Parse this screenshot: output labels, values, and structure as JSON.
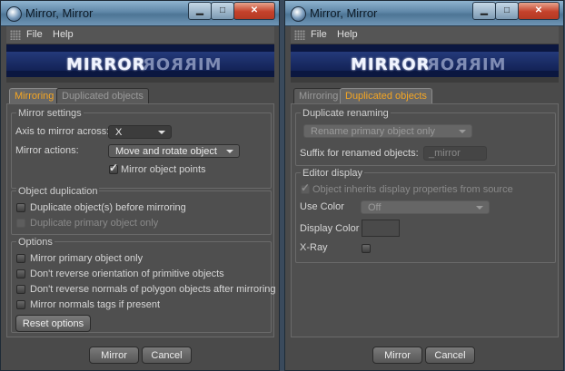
{
  "left_window": {
    "title": "Mirror, Mirror",
    "menu": {
      "file": "File",
      "help": "Help"
    },
    "banner": {
      "word": "MIRROR",
      "reflection": "MIRROR"
    },
    "tabs": [
      {
        "label": "Mirroring",
        "active": true
      },
      {
        "label": "Duplicated objects",
        "active": false
      }
    ],
    "mirror_settings": {
      "title": "Mirror settings",
      "axis_label": "Axis to mirror across:",
      "axis_value": "X",
      "actions_label": "Mirror actions:",
      "actions_value": "Move and rotate object",
      "mirror_points_label": "Mirror object points",
      "mirror_points_checked": true
    },
    "object_duplication": {
      "title": "Object duplication",
      "items": [
        {
          "label": "Duplicate object(s) before mirroring",
          "checked": false,
          "enabled": true
        },
        {
          "label": "Duplicate primary object only",
          "checked": false,
          "enabled": false
        }
      ]
    },
    "options": {
      "title": "Options",
      "items": [
        {
          "label": "Mirror primary object only",
          "checked": false
        },
        {
          "label": "Don't reverse orientation of primitive objects",
          "checked": false
        },
        {
          "label": "Don't reverse normals of polygon objects after mirroring",
          "checked": false
        },
        {
          "label": "Mirror normals tags if present",
          "checked": false
        }
      ],
      "reset_label": "Reset options"
    },
    "footer": {
      "mirror": "Mirror",
      "cancel": "Cancel"
    }
  },
  "right_window": {
    "title": "Mirror, Mirror",
    "menu": {
      "file": "File",
      "help": "Help"
    },
    "banner": {
      "word": "MIRROR",
      "reflection": "MIRROR"
    },
    "tabs": [
      {
        "label": "Mirroring",
        "active": false
      },
      {
        "label": "Duplicated objects",
        "active": true
      }
    ],
    "duplicate_renaming": {
      "title": "Duplicate renaming",
      "rename_value": "Rename primary object only",
      "suffix_label": "Suffix for renamed objects:",
      "suffix_placeholder": "_mirror"
    },
    "editor_display": {
      "title": "Editor display",
      "inherit_label": "Object inherits display properties from source",
      "inherit_checked": true,
      "use_color_label": "Use Color",
      "use_color_value": "Off",
      "display_color_label": "Display Color",
      "xray_label": "X-Ray",
      "xray_checked": false
    },
    "footer": {
      "mirror": "Mirror",
      "cancel": "Cancel"
    }
  },
  "colors": {
    "active_tab": "#f5a623",
    "close_button": "#c4412b",
    "banner": "#0b1740"
  }
}
